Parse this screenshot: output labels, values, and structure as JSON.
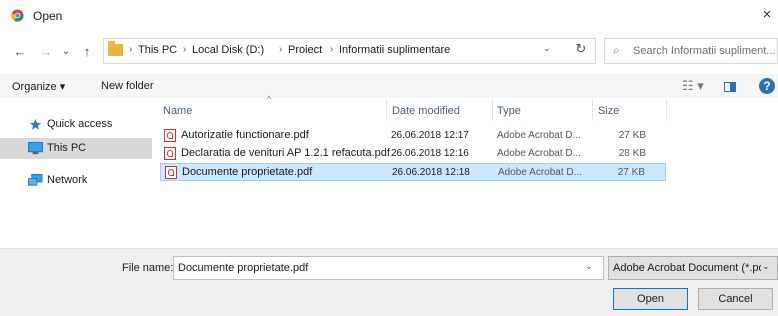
{
  "window": {
    "title": "Open",
    "close_glyph": "×"
  },
  "nav": {
    "back": "←",
    "forward": "→",
    "recent": "⌄",
    "up": "↑"
  },
  "address": {
    "breadcrumbs": [
      "This PC",
      "Local Disk (D:)",
      "Proiect",
      "Informatii suplimentare"
    ],
    "separator": "›",
    "dropdown": "⌄",
    "refresh": "↻"
  },
  "search": {
    "icon": "⌕",
    "placeholder": "Search Informatii supliment..."
  },
  "toolbar": {
    "organize": "Organize ▾",
    "new_folder": "New folder",
    "view_glyph": "☷ ▾",
    "help": "?"
  },
  "sidebar": {
    "items": [
      {
        "label": "Quick access",
        "icon": "star-icon"
      },
      {
        "label": "This PC",
        "icon": "monitor-icon"
      },
      {
        "label": "Network",
        "icon": "network-icon"
      }
    ]
  },
  "columns": {
    "name": "Name",
    "date": "Date modified",
    "type": "Type",
    "size": "Size",
    "sort_caret": "^"
  },
  "files": [
    {
      "name": "Autorizatie functionare.pdf",
      "date": "26.06.2018 12:17",
      "type": "Adobe Acrobat D...",
      "size": "27 KB"
    },
    {
      "name": "Declaratia de venituri AP 1.2.1 refacuta.pdf",
      "date": "26.06.2018 12:16",
      "type": "Adobe Acrobat D...",
      "size": "28 KB"
    },
    {
      "name": "Documente proprietate.pdf",
      "date": "26.06.2018 12:18",
      "type": "Adobe Acrobat D...",
      "size": "27 KB"
    }
  ],
  "bottom": {
    "file_name_label": "File name:",
    "file_name_value": "Documente proprietate.pdf",
    "dropdown": "⌄",
    "filter": "Adobe Acrobat Document (*.pdf)",
    "open": "Open",
    "cancel": "Cancel"
  },
  "colors": {
    "selection": "#cce8ff",
    "accent": "#0078d7",
    "pdf_red": "#c4362c",
    "folder": "#e8b73b"
  }
}
